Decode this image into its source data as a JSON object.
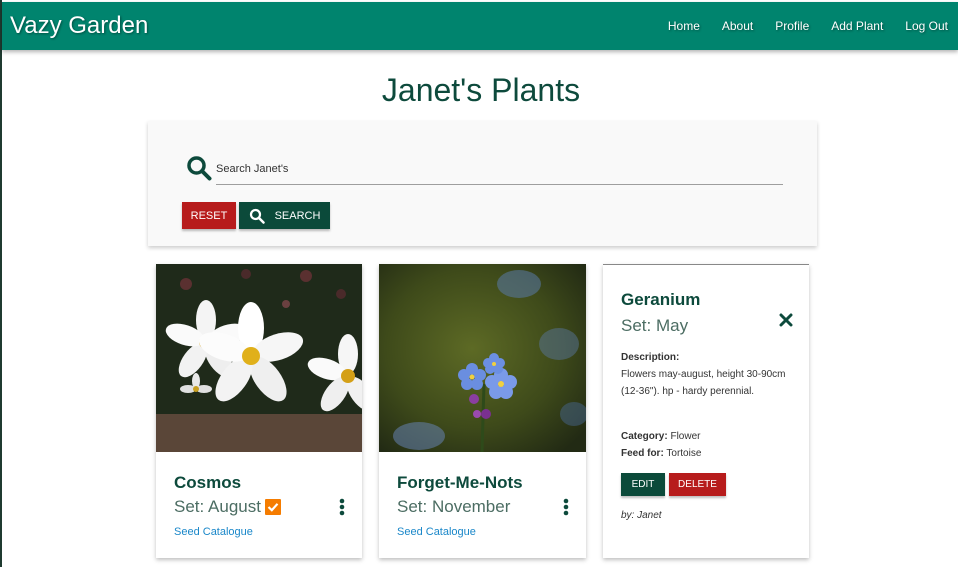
{
  "navbar": {
    "brand": "Vazy Garden",
    "links": [
      "Home",
      "About",
      "Profile",
      "Add Plant",
      "Log Out"
    ],
    "bg_color": "#00846e"
  },
  "page_title": "Janet's Plants",
  "search": {
    "placeholder": "Search Janet's",
    "value": "",
    "reset_label": "RESET",
    "search_label": "SEARCH",
    "icon": "search-icon"
  },
  "cards": [
    {
      "title": "Cosmos",
      "set": "Set: August",
      "checked": true,
      "link": "Seed Catalogue",
      "image": "white cosmos flowers"
    },
    {
      "title": "Forget-Me-Nots",
      "set": "Set: November",
      "checked": false,
      "link": "Seed Catalogue",
      "image": "blue forget-me-not flowers"
    }
  ],
  "reveal_card": {
    "title": "Geranium",
    "set": "Set: May",
    "description_label": "Description:",
    "description": "Flowers may-august, height 30-90cm (12-36\"). hp - hardy perennial.",
    "category_label": "Category:",
    "category": "Flower",
    "feed_label": "Feed for:",
    "feed": "Tortoise",
    "edit_label": "EDIT",
    "delete_label": "DELETE",
    "by": "by: Janet"
  },
  "colors": {
    "primary": "#00846e",
    "dark": "#0b4a3a",
    "danger": "#b71c1c",
    "link": "#1a87c9",
    "check": "#f57c00"
  }
}
